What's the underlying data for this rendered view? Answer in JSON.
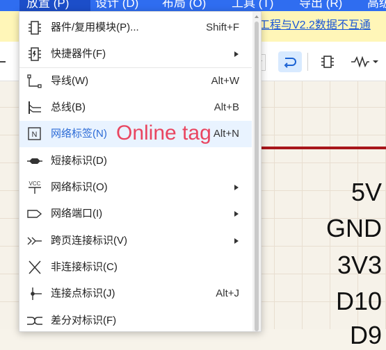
{
  "menubar": {
    "items": [
      "放置 (P)",
      "设计 (D)",
      "布局 (O)",
      "工具 (T)",
      "导出 (R)",
      "高级"
    ]
  },
  "notice": {
    "text": "工程与V2.2数据不互通"
  },
  "canvas": {
    "net_labels": [
      "5V",
      "GND",
      "3V3",
      "D10",
      "D9"
    ]
  },
  "menu": {
    "items": [
      {
        "label": "器件/复用模块(P)...",
        "shortcut": "Shift+F",
        "icon": "component-chip-icon"
      },
      {
        "label": "快捷器件(F)",
        "submenu": true,
        "icon": "quick-component-icon"
      },
      {
        "label": "导线(W)",
        "shortcut": "Alt+W",
        "icon": "wire-icon"
      },
      {
        "label": "总线(B)",
        "shortcut": "Alt+B",
        "icon": "bus-icon"
      },
      {
        "label": "网络标签(N)",
        "shortcut": "Alt+N",
        "icon": "net-label-icon"
      },
      {
        "label": "短接标识(D)",
        "icon": "short-flag-icon"
      },
      {
        "label": "网络标识(O)",
        "submenu": true,
        "icon": "vcc-net-flag-icon"
      },
      {
        "label": "网络端口(I)",
        "submenu": true,
        "icon": "net-port-icon"
      },
      {
        "label": "跨页连接标识(V)",
        "submenu": true,
        "icon": "off-page-connector-icon"
      },
      {
        "label": "非连接标识(C)",
        "icon": "no-connect-icon"
      },
      {
        "label": "连接点标识(J)",
        "shortcut": "Alt+J",
        "icon": "junction-icon"
      },
      {
        "label": "差分对标识(F)",
        "icon": "diff-pair-icon"
      }
    ]
  },
  "overlay": {
    "text": "Online tag"
  },
  "colors": {
    "accent": "#2f6df0",
    "wire": "#a8161b",
    "hover": "#e9f3ff",
    "overlay_text": "#e94560"
  }
}
